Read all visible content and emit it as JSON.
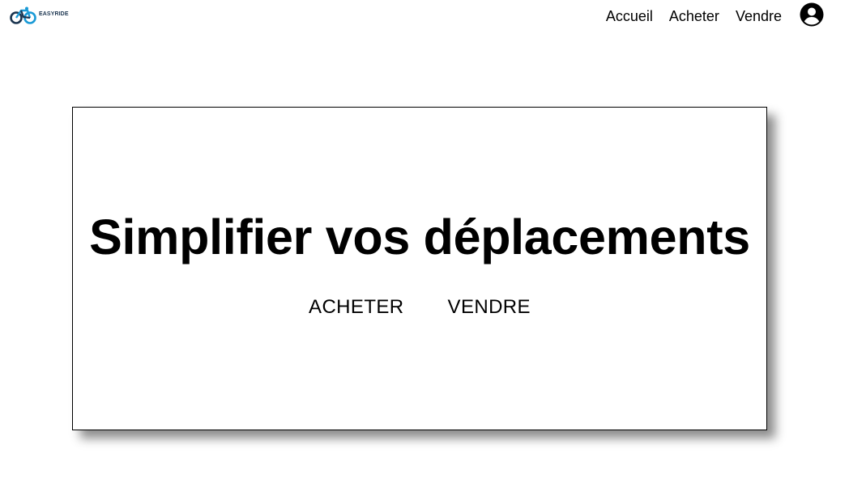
{
  "brand": {
    "name": "EASYRIDE",
    "accent_color": "#1a9ad6",
    "text_color": "#1b3550"
  },
  "nav": {
    "links": [
      {
        "label": "Accueil"
      },
      {
        "label": "Acheter"
      },
      {
        "label": "Vendre"
      }
    ],
    "account_icon": "user-circle-icon"
  },
  "hero": {
    "title": "Simplifier vos déplacements",
    "buttons": [
      {
        "label": "ACHETER"
      },
      {
        "label": "VENDRE"
      }
    ]
  }
}
